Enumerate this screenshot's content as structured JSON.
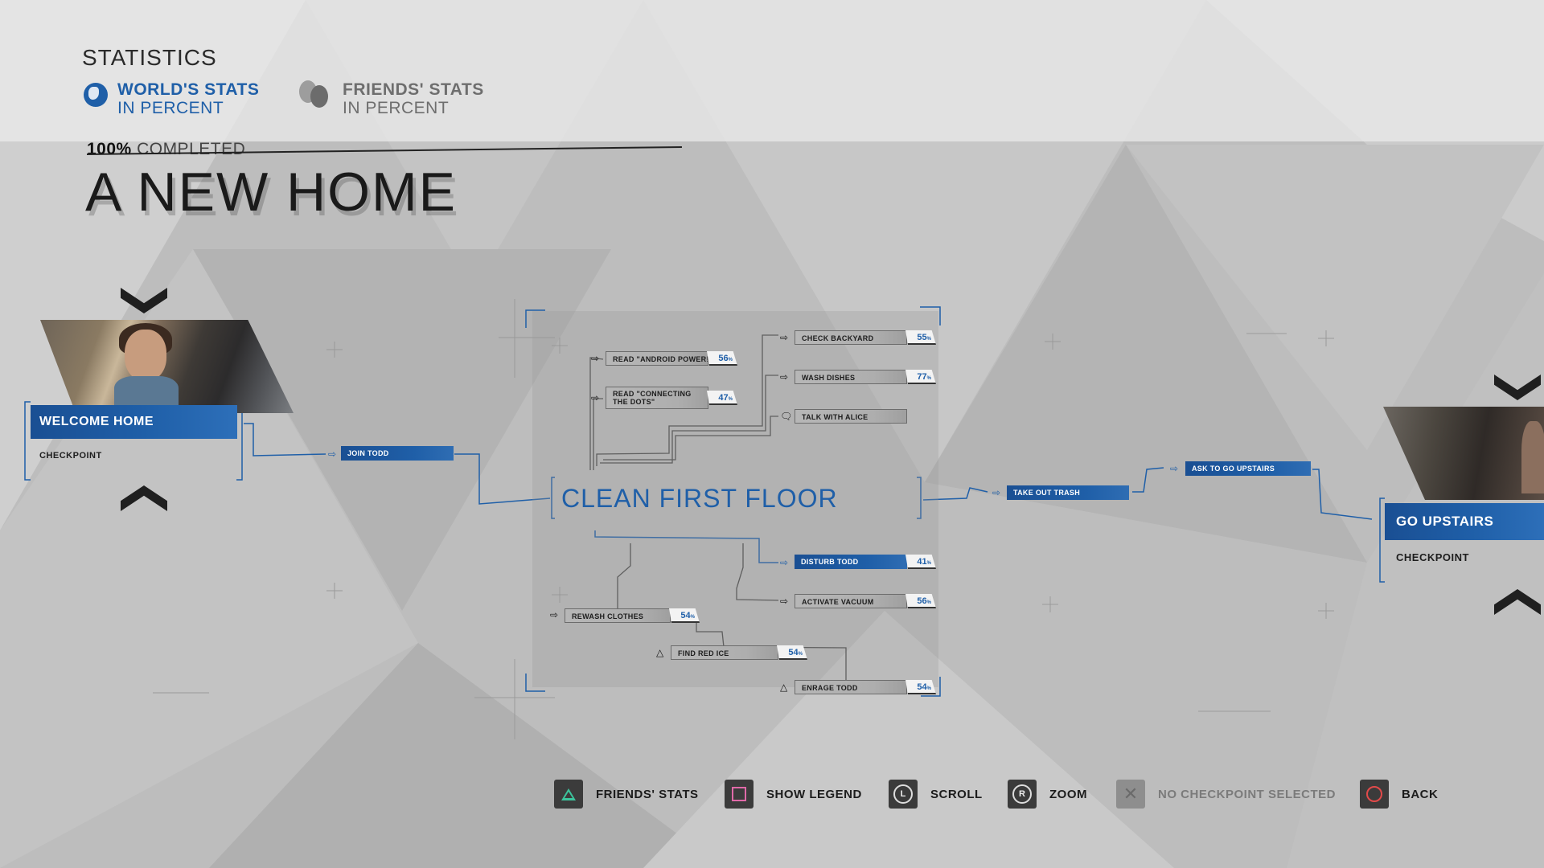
{
  "header": {
    "title": "STATISTICS",
    "world_tab": {
      "line1": "WORLD'S STATS",
      "line2": "IN PERCENT",
      "icon": "globe-icon",
      "color": "#1f5fa8"
    },
    "friends_tab": {
      "line1": "FRIENDS' STATS",
      "line2": "IN PERCENT",
      "icon": "friends-icon",
      "color": "#6e6e6e"
    }
  },
  "chapter": {
    "completion_value": "100%",
    "completion_label": "COMPLETED",
    "title": "A NEW HOME"
  },
  "checkpoints": {
    "left": {
      "title": "WELCOME HOME",
      "subtitle": "CHECKPOINT"
    },
    "right": {
      "title": "GO UPSTAIRS",
      "subtitle": "CHECKPOINT"
    }
  },
  "flow": {
    "join_todd": "JOIN TODD",
    "section_title": "CLEAN FIRST FLOOR",
    "take_out_trash": "TAKE OUT TRASH",
    "ask_upstairs": "ASK TO GO UPSTAIRS",
    "read_android_power": {
      "label": "READ \"ANDROID POWER!\"",
      "pct": "56"
    },
    "read_connecting_dots": {
      "label": "READ \"CONNECTING THE DOTS\"",
      "pct": "47"
    },
    "check_backyard": {
      "label": "CHECK BACKYARD",
      "pct": "55"
    },
    "wash_dishes": {
      "label": "WASH DISHES",
      "pct": "77"
    },
    "talk_with_alice": {
      "label": "TALK WITH ALICE"
    },
    "disturb_todd": {
      "label": "DISTURB TODD",
      "pct": "41"
    },
    "activate_vacuum": {
      "label": "ACTIVATE VACUUM",
      "pct": "56"
    },
    "rewash_clothes": {
      "label": "REWASH CLOTHES",
      "pct": "54"
    },
    "find_red_ice": {
      "label": "FIND RED ICE",
      "pct": "54"
    },
    "enrage_todd": {
      "label": "ENRAGE TODD",
      "pct": "54"
    },
    "pct_sign": "%"
  },
  "footer": {
    "friends_stats": "FRIENDS' STATS",
    "show_legend": "SHOW LEGEND",
    "scroll": "SCROLL",
    "scroll_key": "L",
    "zoom": "ZOOM",
    "zoom_key": "R",
    "no_checkpoint": "NO CHECKPOINT SELECTED",
    "back": "BACK"
  },
  "colors": {
    "accent_blue": "#1f5fa8",
    "triangle": "#3cc49c",
    "square": "#e06aa8",
    "circle": "#e24a4a"
  }
}
